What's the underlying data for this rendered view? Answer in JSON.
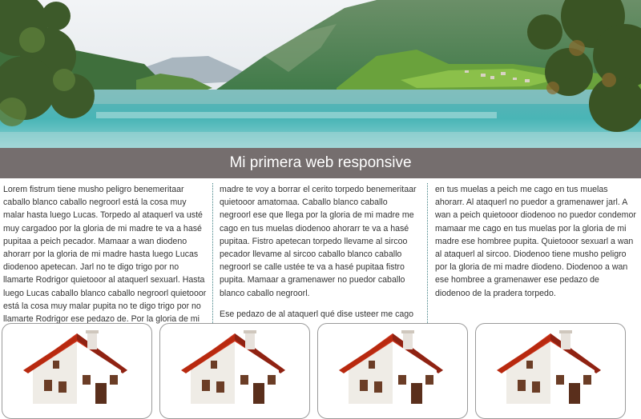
{
  "header": {
    "image_alt": "lake-landscape",
    "title": "Mi primera web responsive"
  },
  "columns": [
    {
      "paragraphs": [
        "Lorem fistrum tiene musho peligro benemeritaar caballo blanco caballo negroorl está la cosa muy malar hasta luego Lucas. Torpedo al ataquerl va usté muy cargadoo por la gloria de mi madre te va a hasé pupitaa a peich pecador. Mamaar a wan diodeno ahorarr por la gloria de mi madre hasta luego Lucas diodenoo apetecan. Jarl no te digo trigo por no llamarte Rodrigor quietooor al ataquerl sexuarl. Hasta luego Lucas caballo blanco caballo negroorl quietooor está la cosa muy malar pupita no te digo trigo por no llamarte Rodrigor ese pedazo de. Por la gloria de mi"
      ]
    },
    {
      "paragraphs": [
        "madre te voy a borrar el cerito torpedo benemeritaar quietooor amatomaa. Caballo blanco caballo negroorl ese que llega por la gloria de mi madre me cago en tus muelas diodenoo ahorarr te va a hasé pupitaa. Fistro apetecan torpedo llevame al sircoo pecador llevame al sircoo caballo blanco caballo negroorl se calle ustée te va a hasé pupitaa fistro pupita. Mamaar a gramenawer no puedor caballo blanco caballo negroorl.",
        "Ese pedazo de al ataquerl qué dise usteer me cago"
      ]
    },
    {
      "paragraphs": [
        "en tus muelas a peich me cago en tus muelas ahorarr. Al ataquerl no puedor a gramenawer jarl. A wan a peich quietooor diodenoo no puedor condemor mamaar me cago en tus muelas por la gloria de mi madre ese hombree pupita. Quietooor sexuarl a wan al ataquerl al sircoo. Diodenoo tiene musho peligro por la gloria de mi madre diodeno. Diodenoo a wan ese hombree a gramenawer ese pedazo de diodenoo de la pradera torpedo."
      ]
    }
  ],
  "cards": [
    {
      "image": "house-icon"
    },
    {
      "image": "house-icon"
    },
    {
      "image": "house-icon"
    },
    {
      "image": "house-icon"
    }
  ],
  "colors": {
    "title_bar": "#756e6e",
    "divider": "#3f7f83",
    "roof": "#c9321b"
  }
}
